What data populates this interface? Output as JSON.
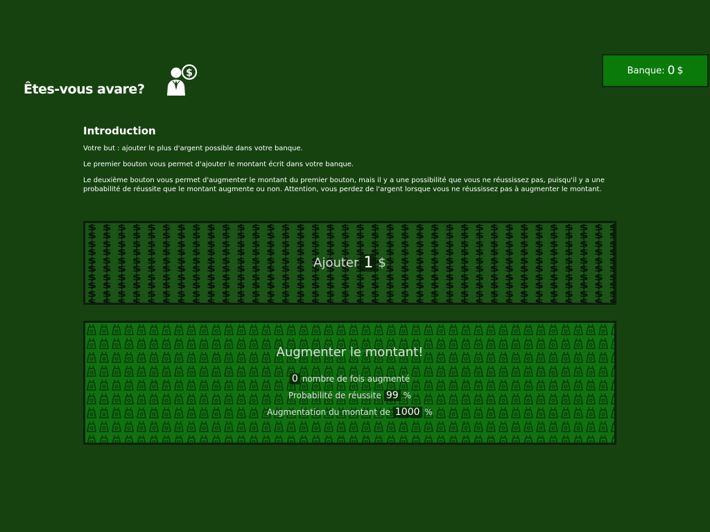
{
  "bank": {
    "label": "Banque:",
    "amount": "0",
    "currency": "$"
  },
  "header": {
    "title": "Êtes-vous avare?",
    "logo_icon": "person-dollar-icon"
  },
  "intro": {
    "heading": "Introduction",
    "paragraphs": [
      "Votre but : ajouter le plus d'argent possible dans votre banque.",
      "Le premier bouton vous permet d'ajouter le montant écrit dans votre banque.",
      "Le deuxième bouton vous permet d'augmenter le montant du premier bouton, mais il y a une possibilité que vous ne réussissez pas, puisqu'il y a une probabilité de réussite que le montant augmente ou non. Attention, vous perdez de l'argent lorsque vous ne réussissez pas à augmenter le montant."
    ]
  },
  "add_button": {
    "prefix": "Ajouter",
    "amount": "1",
    "currency": "$",
    "pattern_icon": "dollar-sign-icon"
  },
  "increase_button": {
    "title": "Augmenter le montant!",
    "times_count": "0",
    "times_label": "nombre de fois augmenté",
    "probability_label": "Probabilité de réussite",
    "probability_value": "99",
    "probability_suffix": "%",
    "increase_label": "Augmentation du montant de",
    "increase_value": "1000",
    "increase_suffix": "%",
    "pattern_icon": "money-bag-icon"
  },
  "colors": {
    "background": "#164210",
    "bank_box": "#0a7a0a",
    "add_panel": "#1b5416",
    "increase_panel": "#0f720f"
  }
}
